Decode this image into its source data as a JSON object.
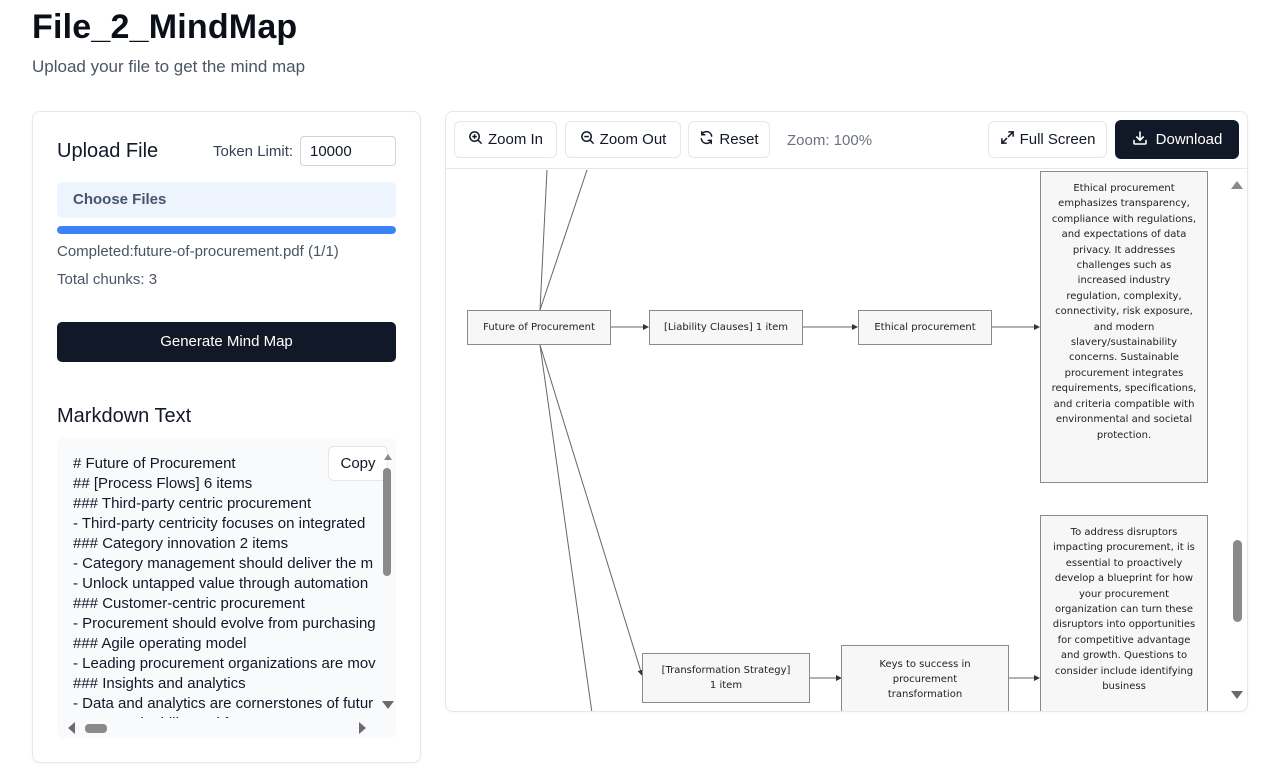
{
  "header": {
    "title": "File_2_MindMap",
    "subtitle": "Upload your file to get the mind map"
  },
  "upload": {
    "title": "Upload File",
    "token_label": "Token Limit:",
    "token_value": "10000",
    "choose_label": "Choose Files",
    "progress_percent": 100,
    "status": "Completed:future-of-procurement.pdf (1/1)",
    "chunks": "Total chunks: 3",
    "generate_label": "Generate Mind Map"
  },
  "markdown": {
    "title": "Markdown Text",
    "copy_label": "Copy",
    "lines": [
      "# Future of Procurement",
      "## [Process Flows] 6 items",
      "### Third-party centric procurement",
      "- Third-party centricity focuses on integrated",
      "### Category innovation 2 items",
      "- Category management should deliver the m",
      "- Unlock untapped value through automation",
      "### Customer-centric procurement",
      "- Procurement should evolve from purchasing",
      "### Agile operating model",
      "- Leading procurement organizations are mov",
      "### Insights and analytics",
      "- Data and analytics are cornerstones of futur",
      "### Sustainability and f"
    ]
  },
  "toolbar": {
    "zoom_in": "Zoom In",
    "zoom_out": "Zoom Out",
    "reset": "Reset",
    "zoom_level": "Zoom: 100%",
    "full_screen": "Full Screen",
    "download": "Download"
  },
  "mindmap": {
    "root": "Future of Procurement",
    "liability": "[Liability Clauses] 1 item",
    "ethical": "Ethical procurement",
    "ethical_desc": "Ethical procurement emphasizes transparency, compliance with regulations, and expectations of data privacy. It addresses challenges such as increased industry regulation, complexity, connectivity, risk exposure, and modern slavery/sustainability concerns. Sustainable procurement integrates requirements, specifications, and criteria compatible with environmental and societal protection.",
    "transformation": "[Transformation Strategy] 1 item",
    "keys": "Keys to success in procurement transformation",
    "keys_desc": "To address disruptors impacting procurement, it is essential to proactively develop a blueprint for how your procurement organization can turn these disruptors into opportunities for competitive advantage and growth. Questions to consider include identifying business"
  }
}
